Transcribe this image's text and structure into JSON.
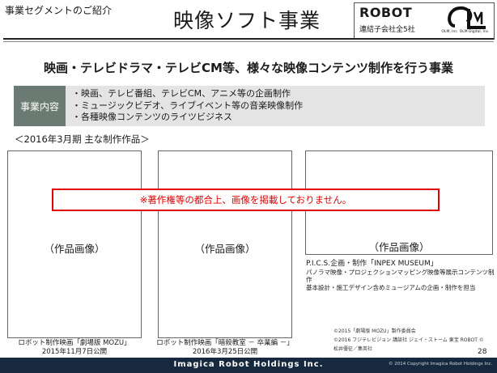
{
  "header": {
    "section_label": "事業セグメントのご紹介",
    "title": "映像ソフト事業",
    "logo": {
      "robot_word": "ROBOT",
      "robot_sub": "連結子会社全5社",
      "olm_text": "OLM, Inc.  OLM Digital, Inc."
    }
  },
  "headline": "映画・テレビドラマ・テレビCM等、様々な映像コンテンツ制作を行う事業",
  "business": {
    "label": "事業内容",
    "items": [
      "・映画、テレビ番組、テレビCM、アニメ等の企画制作",
      "・ミュージックビデオ、ライブイベント等の音楽映像制作",
      "・各種映像コンテンツのライツビジネス"
    ]
  },
  "period_label": "＜2016年3月期 主な制作作品＞",
  "works": [
    {
      "placeholder": "（作品画像）",
      "caption_1": "ロボット制作映画「劇場版 MOZU」",
      "caption_2": "2015年11月7日公開"
    },
    {
      "placeholder": "（作品画像）",
      "caption_1": "ロボット制作映画「暗殺教室 － 卒業編 －」",
      "caption_2": "2016年3月25日公開"
    },
    {
      "placeholder": "（作品画像）",
      "caption_1": "P.I.C.S.企画・制作「INPEX MUSEUM」",
      "caption_2": "パノラマ映像・プロジェクションマッピング映像等展示コンテンツ制作",
      "caption_3": "基本設計・施工デザイン含めミュージアムの企画・制作を担当"
    }
  ],
  "notice": "※著作権等の都合上、画像を掲載しておりません。",
  "copyright": {
    "line1": "©2015「劇場版 MOZU」製作委員会",
    "line2": "©2016 フジテレビジョン  講談社  ジェイ・ストーム  東宝  ROBOT  ©",
    "line3": "松井優征／集英社"
  },
  "page_number": "28",
  "footer": {
    "company": "Imagica Robot Holdings Inc.",
    "copyright": "© 2014 Copyright Imagica Robot Holdings Inc."
  },
  "colors": {
    "footer_bar": "#17293f",
    "label_box": "#6b7b73",
    "notice_red": "#e00000",
    "biz_bg": "#e4e4e4"
  }
}
